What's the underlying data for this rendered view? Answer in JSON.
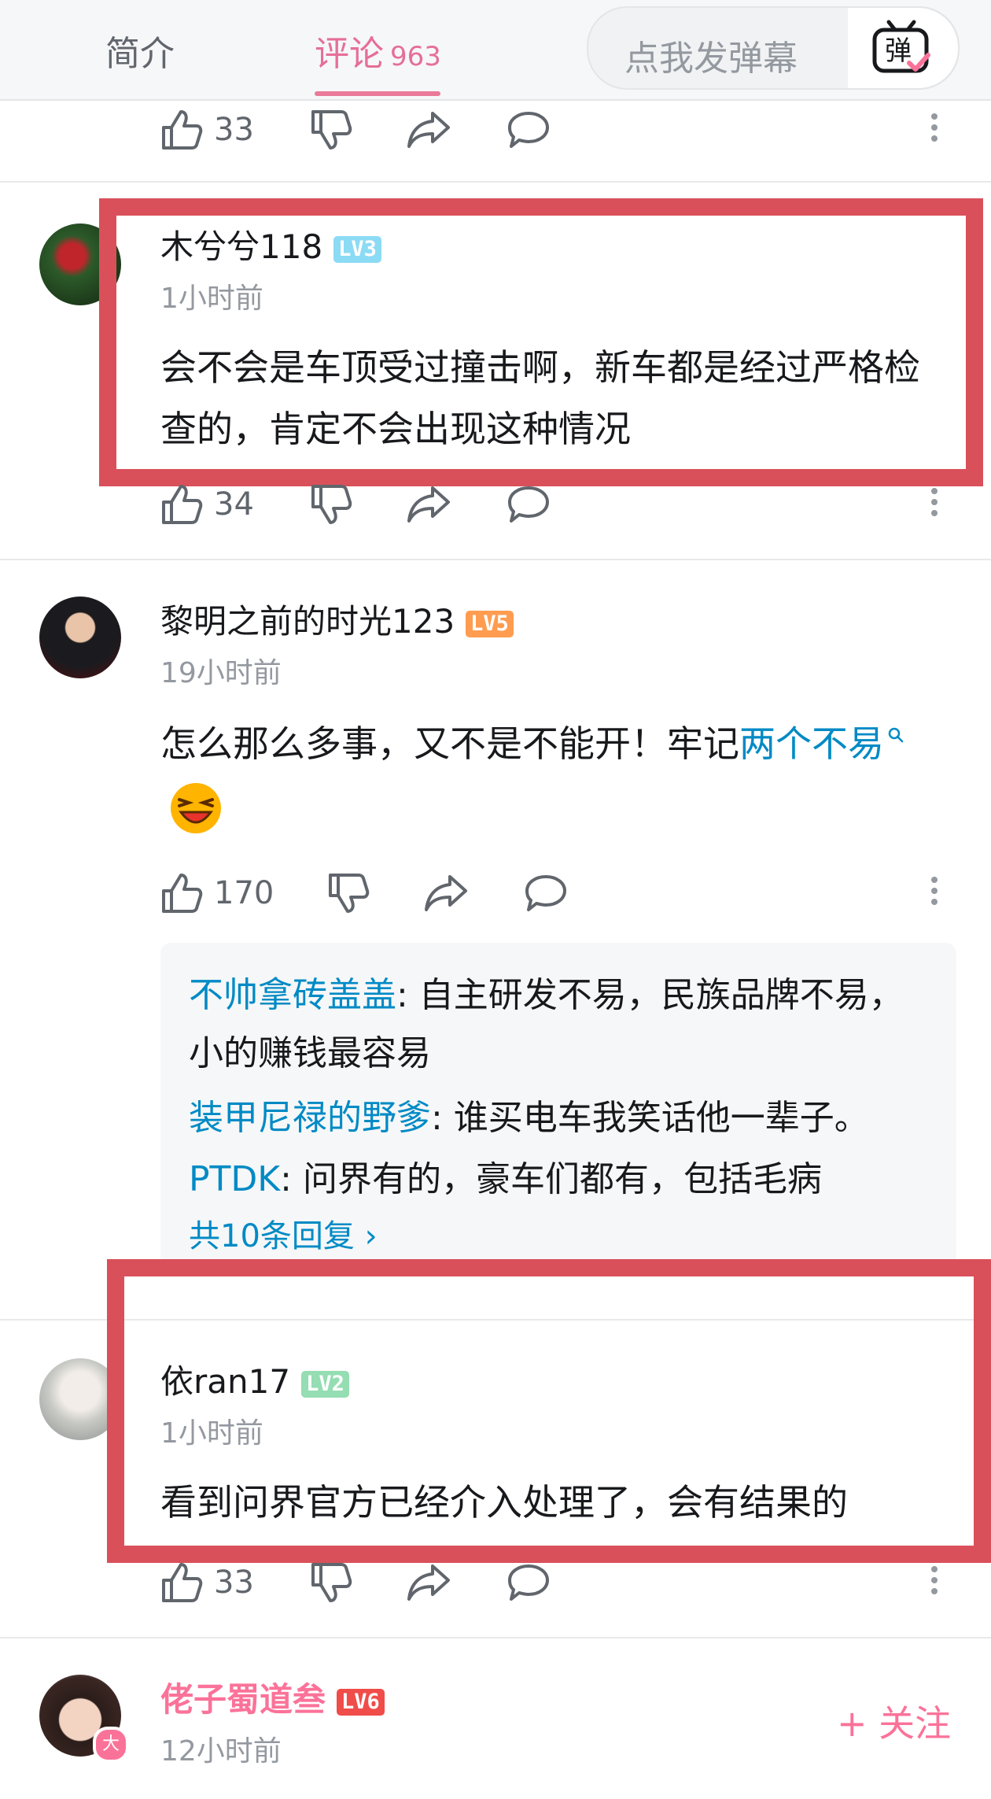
{
  "header": {
    "tab_intro": "简介",
    "tab_comments": "评论",
    "comment_count": "963",
    "danmaku_placeholder": "点我发弹幕",
    "danmaku_icon_label": "弹",
    "accent_color": "#e56f97"
  },
  "top_actions": {
    "like_count": "33"
  },
  "comments": [
    {
      "username": "木兮兮118",
      "level": "LV3",
      "time": "1小时前",
      "content": "会不会是车顶受过撞击啊，新车都是经过严格检查的，肯定不会出现这种情况",
      "like_count": "34"
    },
    {
      "username": "黎明之前的时光123",
      "level": "LV5",
      "time": "19小时前",
      "content_prefix": "怎么那么多事，又不是不能开！牢记",
      "content_link": "两个不易",
      "like_count": "170",
      "replies": [
        {
          "name": "不帅拿砖盖盖",
          "text": ": 自主研发不易，民族品牌不易，小的赚钱最容易"
        },
        {
          "name": "装甲尼禄的野爹",
          "text": ": 谁买电车我笑话他一辈子。"
        },
        {
          "name": "PTDK",
          "text": ": 问界有的，豪车们都有，包括毛病"
        }
      ],
      "reply_more": "共10条回复 ›"
    },
    {
      "username": "依ran17",
      "level": "LV2",
      "time": "1小时前",
      "content": "看到问界官方已经介入处理了，会有结果的",
      "like_count": "33"
    },
    {
      "username": "佬子蜀道叁",
      "level": "LV6",
      "time": "12小时前",
      "badge": "大",
      "follow": "+ 关注"
    }
  ]
}
